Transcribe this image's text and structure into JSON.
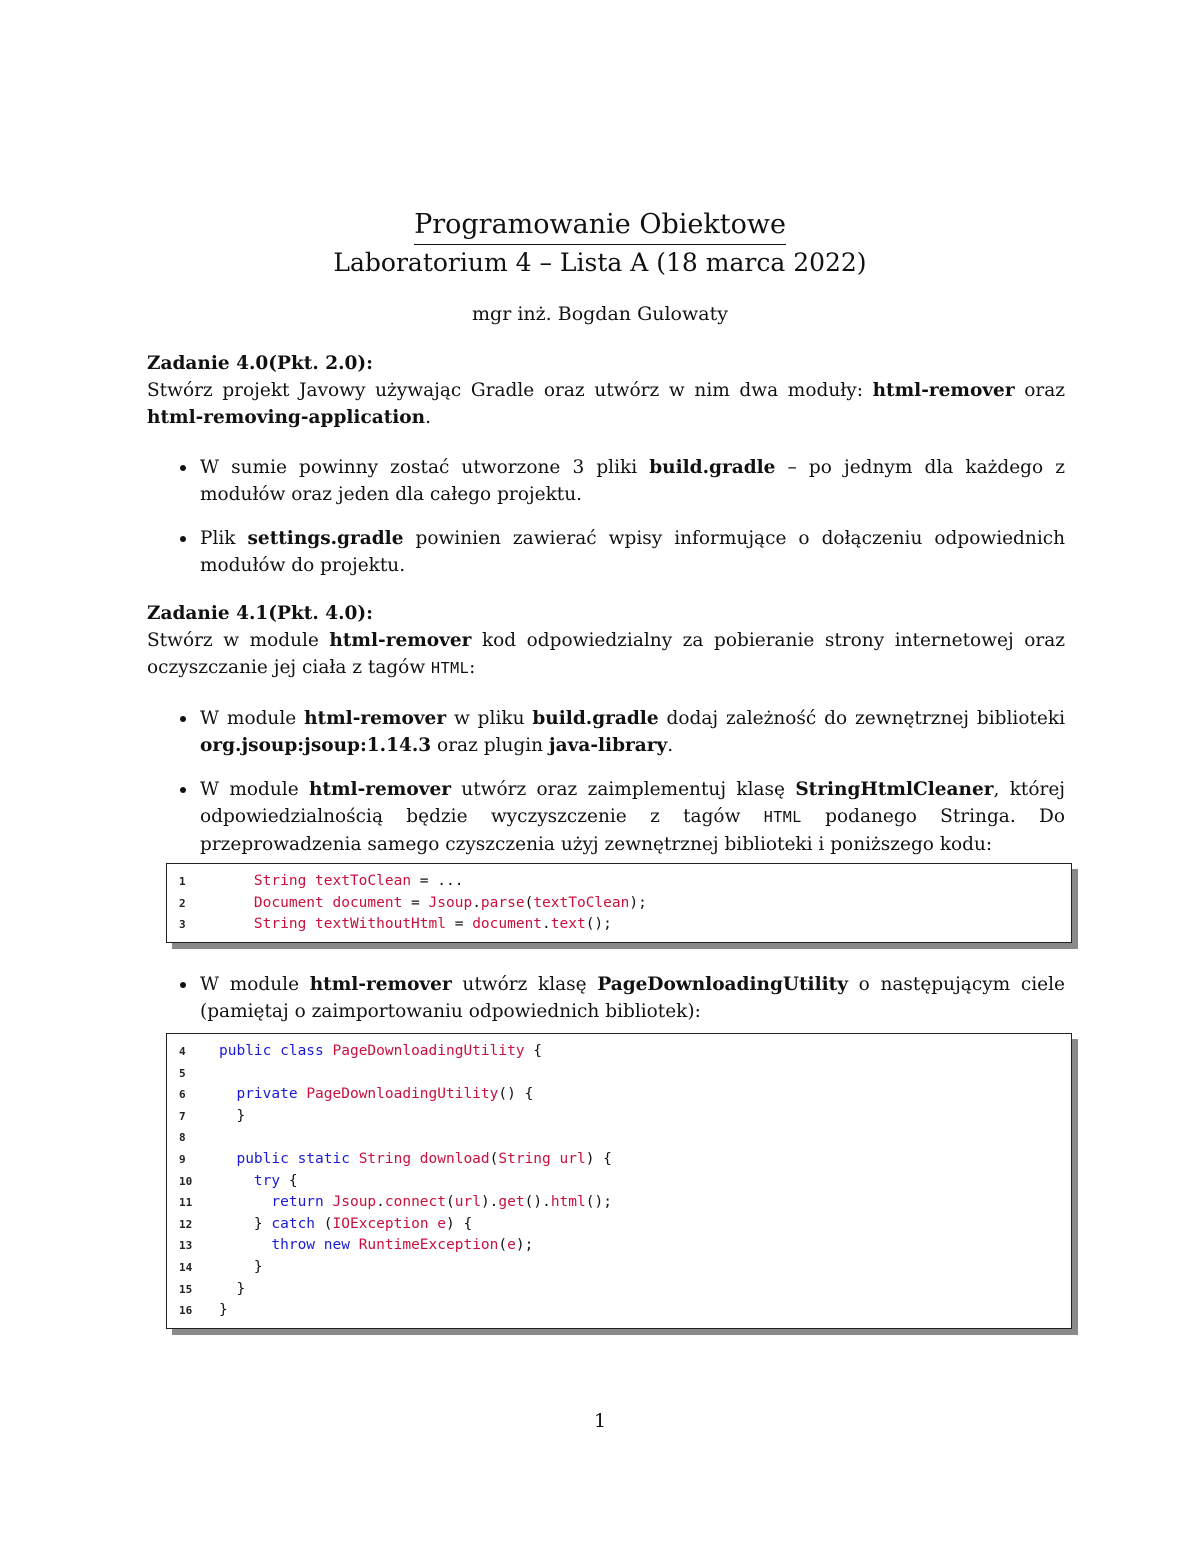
{
  "header": {
    "title": "Programowanie Obiektowe",
    "subtitle": "Laboratorium 4 – Lista A (18 marca 2022)",
    "author": "mgr inż. Bogdan Gulowaty"
  },
  "task_4_0": {
    "heading": "Zadanie 4.0(Pkt. 2.0):",
    "intro_parts": [
      "Stwórz projekt Javowy używając Gradle oraz utwórz w nim dwa moduły: ",
      "html-remover",
      " oraz ",
      "html-removing-application",
      "."
    ],
    "bullets": [
      {
        "parts": [
          "W sumie powinny zostać utworzone 3 pliki ",
          "build.gradle",
          " – po jednym dla każdego z modułów oraz jeden dla całego projektu."
        ]
      },
      {
        "parts": [
          "Plik ",
          "settings.gradle",
          " powinien zawierać wpisy informujące o dołączeniu odpowiednich modułów do projektu."
        ]
      }
    ]
  },
  "task_4_1": {
    "heading": "Zadanie 4.1(Pkt. 4.0):",
    "intro_parts": [
      "Stwórz w module ",
      "html-remover",
      " kod odpowiedzialny za pobieranie strony internetowej oraz oczyszczanie jej ciała z tagów ",
      "HTML",
      ":"
    ],
    "bullets": [
      {
        "parts": [
          "W module ",
          "html-remover",
          " w pliku ",
          "build.gradle",
          " dodaj zależność do zewnętrznej biblioteki ",
          "org.jsoup:jsoup:1.14.3",
          " oraz plugin ",
          "java-library",
          "."
        ]
      },
      {
        "parts": [
          "W module ",
          "html-remover",
          " utwórz oraz zaimplementuj klasę ",
          "StringHtmlCleaner",
          ", której odpowiedzialnością będzie wyczyszczenie z tagów ",
          "HTML",
          " podanego Stringa. Do przeprowadzenia samego czyszczenia użyj zewnętrznej biblioteki i poniższego kodu:"
        ]
      },
      {
        "parts": [
          "W module ",
          "html-remover",
          " utwórz klasę ",
          "PageDownloadingUtility",
          " o następującym ciele (pamiętaj o zaimportowaniu odpowiednich bibliotek):"
        ]
      }
    ]
  },
  "code_block_1": {
    "lines": [
      {
        "n": "1",
        "indent": "  ",
        "tokens": [
          [
            "id",
            "String textToClean"
          ],
          [
            "pn",
            " = ..."
          ]
        ]
      },
      {
        "n": "2",
        "indent": "  ",
        "tokens": [
          [
            "id",
            "Document document"
          ],
          [
            "pn",
            " = "
          ],
          [
            "id",
            "Jsoup"
          ],
          [
            "pn",
            "."
          ],
          [
            "id",
            "parse"
          ],
          [
            "pn",
            "("
          ],
          [
            "id",
            "textToClean"
          ],
          [
            "pn",
            ");"
          ]
        ]
      },
      {
        "n": "3",
        "indent": "  ",
        "tokens": [
          [
            "id",
            "String textWithoutHtml"
          ],
          [
            "pn",
            " = "
          ],
          [
            "id",
            "document"
          ],
          [
            "pn",
            "."
          ],
          [
            "id",
            "text"
          ],
          [
            "pn",
            "();"
          ]
        ]
      }
    ]
  },
  "code_block_2": {
    "lines": [
      {
        "n": "4",
        "indent": "",
        "tokens": [
          [
            "kw",
            "public class "
          ],
          [
            "id",
            "PageDownloadingUtility"
          ],
          [
            "pn",
            " {"
          ]
        ]
      },
      {
        "n": "5",
        "indent": "",
        "tokens": []
      },
      {
        "n": "6",
        "indent": "  ",
        "tokens": [
          [
            "kw",
            "private "
          ],
          [
            "id",
            "PageDownloadingUtility"
          ],
          [
            "pn",
            "() {"
          ]
        ]
      },
      {
        "n": "7",
        "indent": "  ",
        "tokens": [
          [
            "pn",
            "}"
          ]
        ]
      },
      {
        "n": "8",
        "indent": "",
        "tokens": []
      },
      {
        "n": "9",
        "indent": "  ",
        "tokens": [
          [
            "kw",
            "public static "
          ],
          [
            "id",
            "String download"
          ],
          [
            "pn",
            "("
          ],
          [
            "id",
            "String url"
          ],
          [
            "pn",
            ") {"
          ]
        ]
      },
      {
        "n": "10",
        "indent": "    ",
        "tokens": [
          [
            "kw",
            "try"
          ],
          [
            "pn",
            " {"
          ]
        ]
      },
      {
        "n": "11",
        "indent": "      ",
        "tokens": [
          [
            "kw",
            "return "
          ],
          [
            "id",
            "Jsoup"
          ],
          [
            "pn",
            "."
          ],
          [
            "id",
            "connect"
          ],
          [
            "pn",
            "("
          ],
          [
            "id",
            "url"
          ],
          [
            "pn",
            ")."
          ],
          [
            "id",
            "get"
          ],
          [
            "pn",
            "()."
          ],
          [
            "id",
            "html"
          ],
          [
            "pn",
            "();"
          ]
        ]
      },
      {
        "n": "12",
        "indent": "    ",
        "tokens": [
          [
            "pn",
            "} "
          ],
          [
            "kw",
            "catch"
          ],
          [
            "pn",
            " ("
          ],
          [
            "id",
            "IOException e"
          ],
          [
            "pn",
            ") {"
          ]
        ]
      },
      {
        "n": "13",
        "indent": "      ",
        "tokens": [
          [
            "kw",
            "throw new "
          ],
          [
            "id",
            "RuntimeException"
          ],
          [
            "pn",
            "("
          ],
          [
            "id",
            "e"
          ],
          [
            "pn",
            ");"
          ]
        ]
      },
      {
        "n": "14",
        "indent": "    ",
        "tokens": [
          [
            "pn",
            "}"
          ]
        ]
      },
      {
        "n": "15",
        "indent": "  ",
        "tokens": [
          [
            "pn",
            "}"
          ]
        ]
      },
      {
        "n": "16",
        "indent": "",
        "tokens": [
          [
            "pn",
            "}"
          ]
        ]
      }
    ]
  },
  "colors": {
    "keyword": "#1a1ad6",
    "identifier": "#c8103e",
    "punctuation": "#111111",
    "shadow": "#8a8a8a"
  },
  "footer": {
    "page_number": "1"
  }
}
